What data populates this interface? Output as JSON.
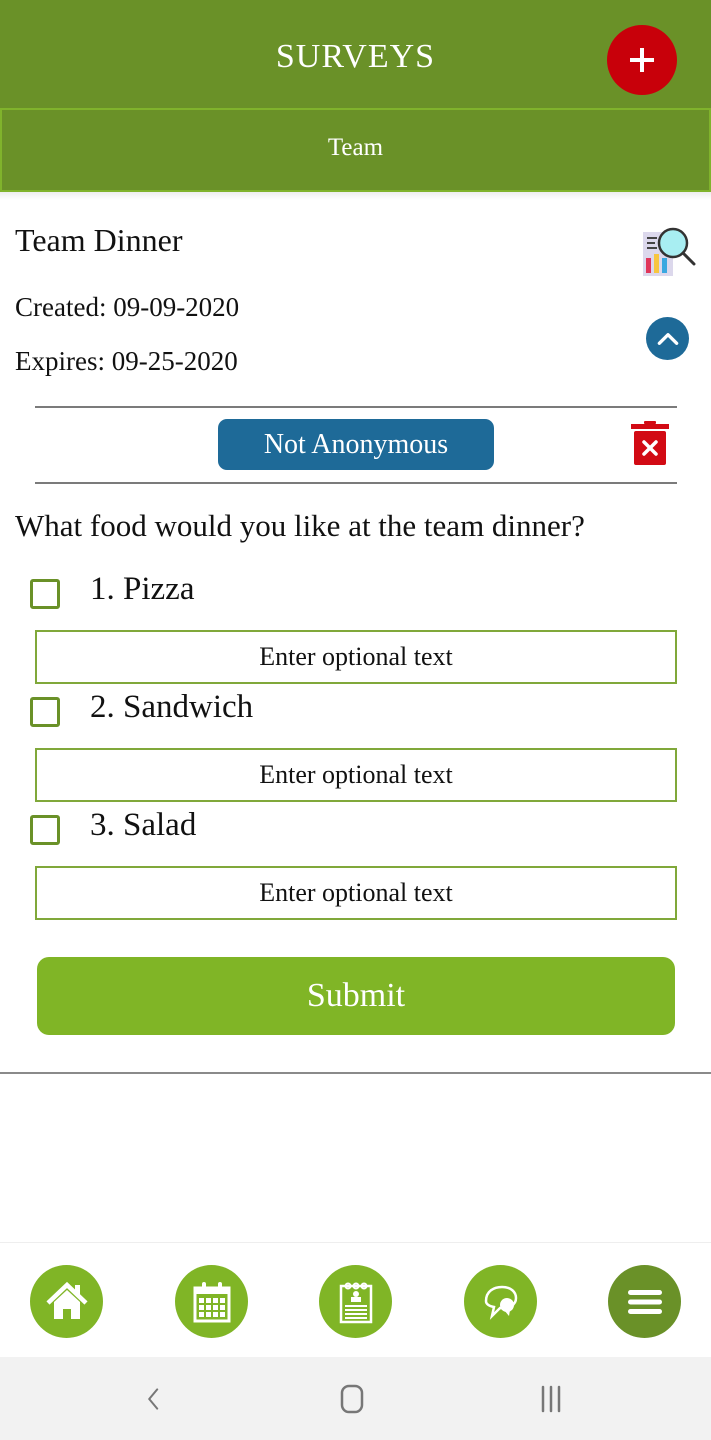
{
  "header": {
    "title": "SURVEYS",
    "add_button_icon": "plus-icon",
    "add_button_color": "#c8000a",
    "background_color": "#6a9128"
  },
  "tab": {
    "label": "Team"
  },
  "survey": {
    "title": "Team Dinner",
    "created": "Created: 09-09-2020",
    "expires": "Expires: 09-25-2020",
    "results_icon": "chart-search-icon",
    "collapse_icon": "chevron-up-icon",
    "anonymity_label": "Not Anonymous",
    "delete_icon": "trash-icon",
    "question": "What food would you like at the team dinner?",
    "options": [
      {
        "label": "1. Pizza",
        "checked": false,
        "text_placeholder": "Enter optional text",
        "text_value": ""
      },
      {
        "label": "2. Sandwich",
        "checked": false,
        "text_placeholder": "Enter optional text",
        "text_value": ""
      },
      {
        "label": "3. Salad",
        "checked": false,
        "text_placeholder": "Enter optional text",
        "text_value": ""
      }
    ],
    "submit_label": "Submit",
    "accent_color": "#80b526",
    "badge_color": "#1e6a98"
  },
  "bottom_nav": {
    "items": [
      {
        "name": "home",
        "icon": "home-icon",
        "active": false
      },
      {
        "name": "calendar",
        "icon": "calendar-icon",
        "active": false
      },
      {
        "name": "surveys",
        "icon": "clipboard-icon",
        "active": false
      },
      {
        "name": "chat",
        "icon": "chat-bubbles-icon",
        "active": false
      },
      {
        "name": "menu",
        "icon": "hamburger-menu-icon",
        "active": true
      }
    ]
  },
  "system_nav": {
    "buttons": [
      "back",
      "home",
      "recent-apps"
    ]
  }
}
